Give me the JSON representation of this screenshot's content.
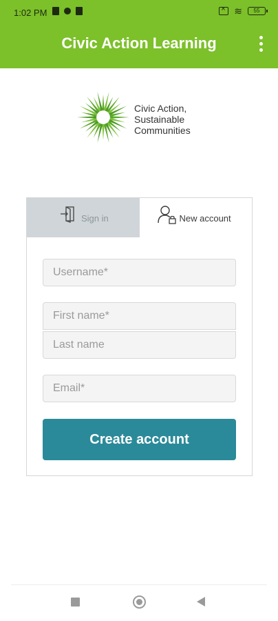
{
  "status_bar": {
    "time": "1:02 PM",
    "battery": "55"
  },
  "app_bar": {
    "title": "Civic Action Learning"
  },
  "logo": {
    "text": "Civic Action, Sustainable Communities"
  },
  "auth": {
    "tabs": [
      {
        "label": "Sign in",
        "active": false
      },
      {
        "label": "New account",
        "active": true
      }
    ],
    "fields": {
      "username_placeholder": "Username*",
      "first_name_placeholder": "First name*",
      "last_name_placeholder": "Last name",
      "email_placeholder": "Email*"
    },
    "submit_label": "Create account"
  },
  "colors": {
    "app_bar": "#7cc02a",
    "primary_button": "#2b8a99",
    "inactive_tab": "#cfd5d8"
  }
}
